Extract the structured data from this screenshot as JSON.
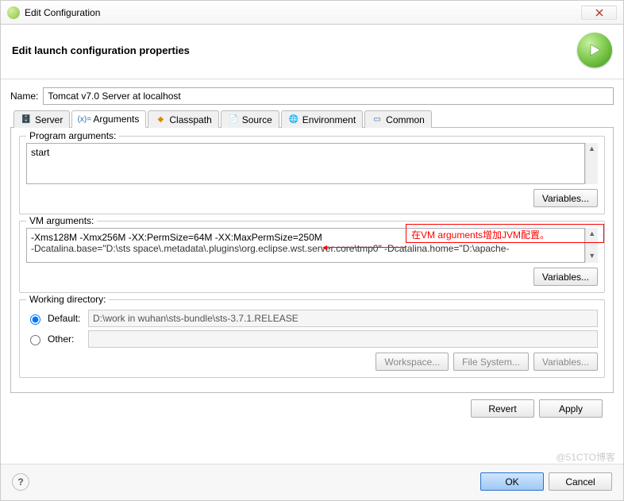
{
  "window": {
    "title": "Edit Configuration"
  },
  "header": {
    "title": "Edit launch configuration properties"
  },
  "name": {
    "label": "Name:",
    "value": "Tomcat v7.0 Server at localhost"
  },
  "tabs": {
    "server": "Server",
    "arguments": "Arguments",
    "classpath": "Classpath",
    "source": "Source",
    "environment": "Environment",
    "common": "Common"
  },
  "arguments": {
    "program_label": "Program arguments:",
    "program_value": "start",
    "vm_label": "VM arguments:",
    "vm_line1": "-Xms128M -Xmx256M -XX:PermSize=64M -XX:MaxPermSize=250M",
    "vm_line2": "-Dcatalina.base=\"D:\\sts space\\.metadata\\.plugins\\org.eclipse.wst.server.core\\tmp0\" -Dcatalina.home=\"D:\\apache-",
    "variables_btn": "Variables..."
  },
  "workdir": {
    "label": "Working directory:",
    "default_label": "Default:",
    "default_value": "D:\\work in wuhan\\sts-bundle\\sts-3.7.1.RELEASE",
    "other_label": "Other:",
    "workspace_btn": "Workspace...",
    "filesystem_btn": "File System...",
    "variables_btn": "Variables..."
  },
  "buttons": {
    "revert": "Revert",
    "apply": "Apply",
    "ok": "OK",
    "cancel": "Cancel"
  },
  "annotation": {
    "text": "在VM arguments增加JVM配置。"
  },
  "watermark": "@51CTO博客"
}
